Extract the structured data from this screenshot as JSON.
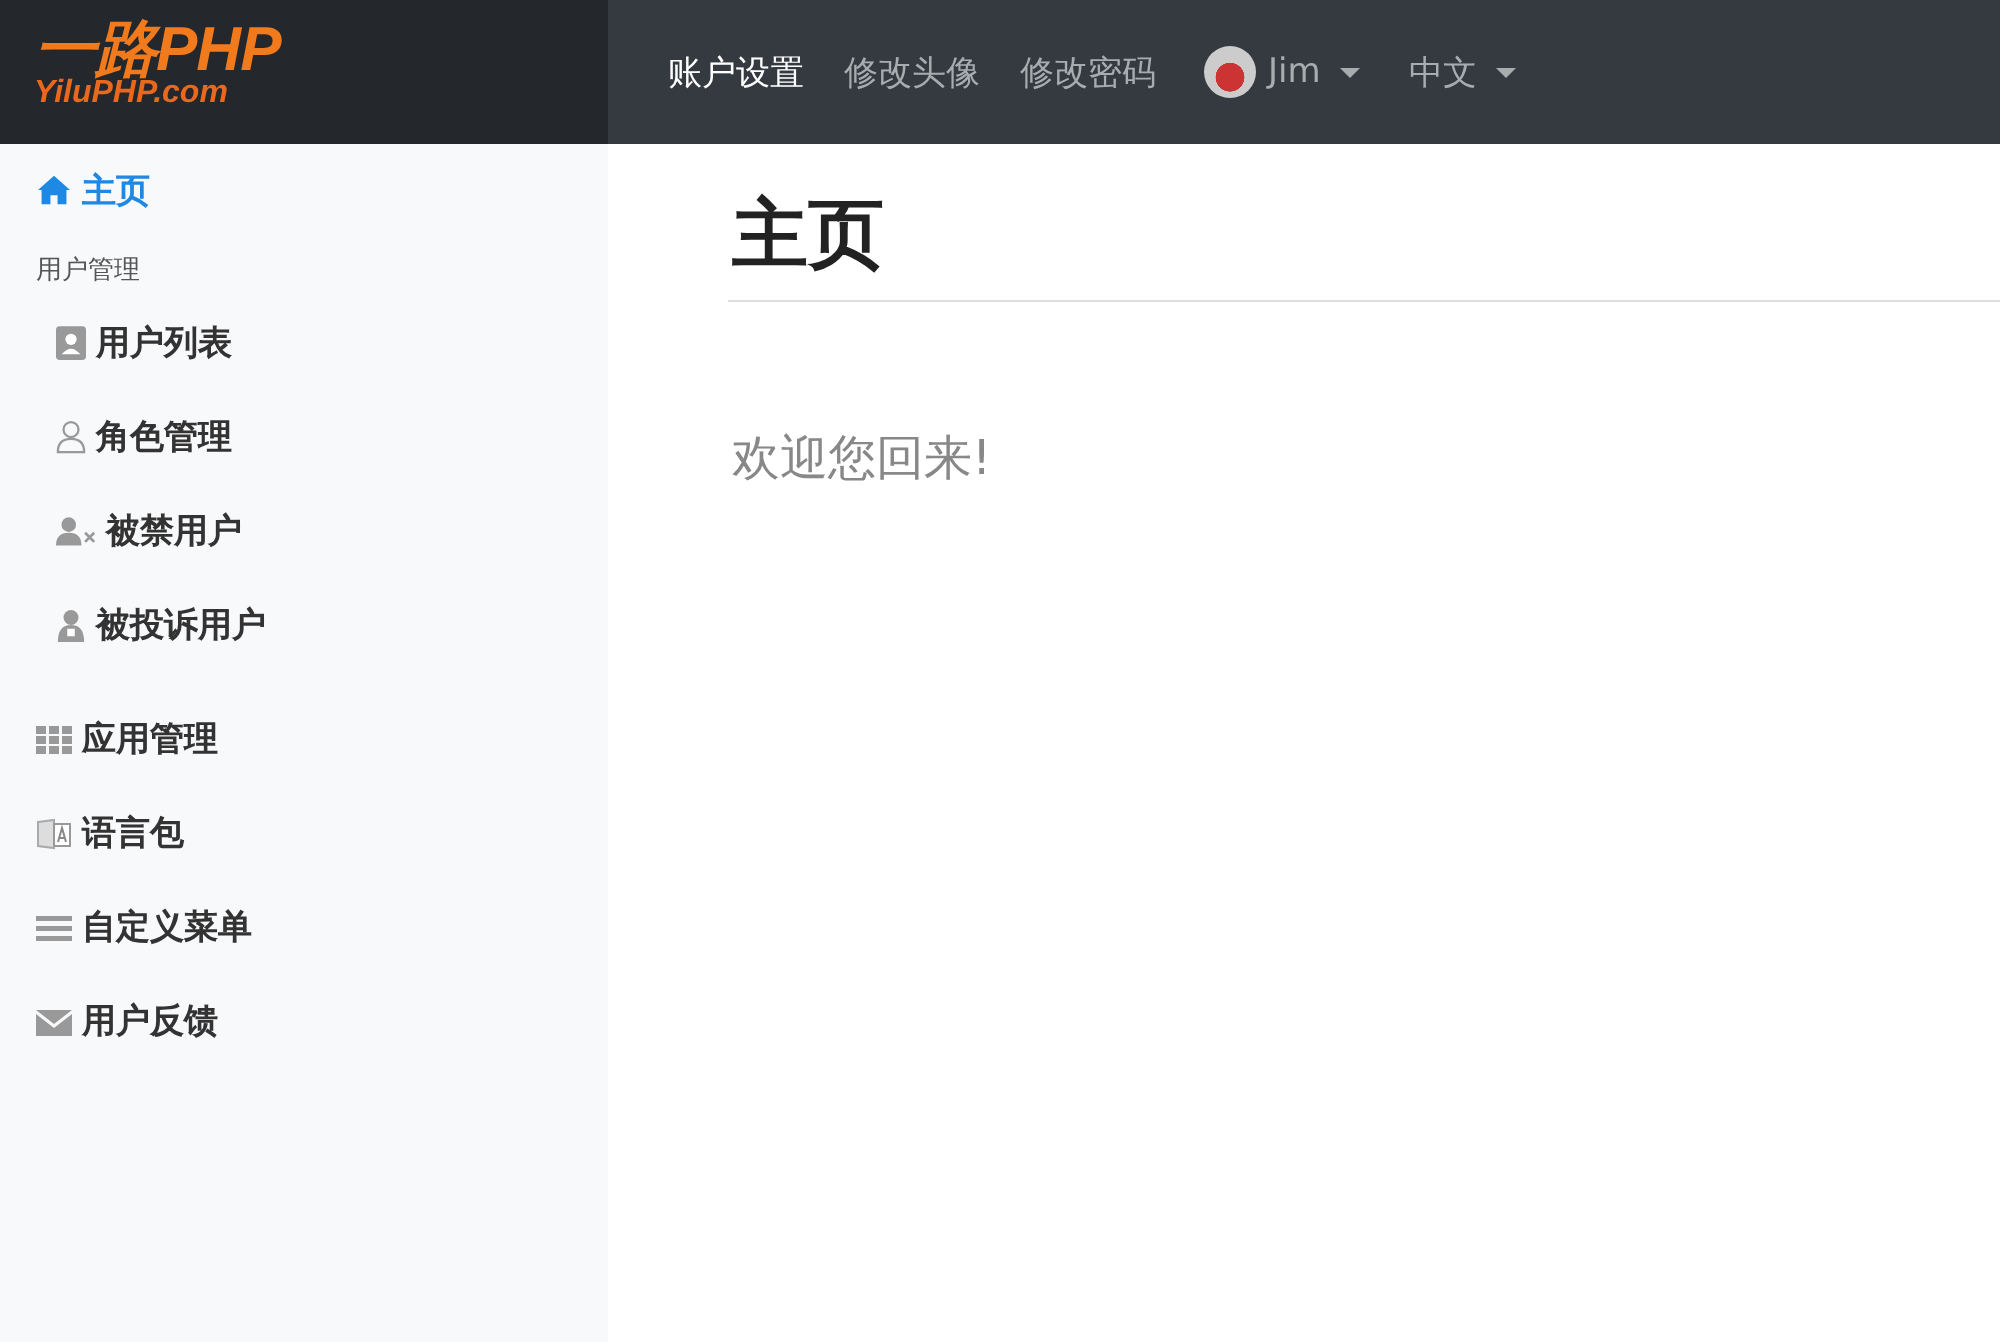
{
  "logo": {
    "title": "一路PHP",
    "subtitle": "YiluPHP.com"
  },
  "nav": {
    "links": [
      {
        "label": "账户设置",
        "selected": true
      },
      {
        "label": "修改头像",
        "selected": false
      },
      {
        "label": "修改密码",
        "selected": false
      }
    ],
    "user_menu": {
      "name": "Jim"
    },
    "language_menu": {
      "label": "中文"
    }
  },
  "sidebar": {
    "items": [
      {
        "kind": "link",
        "label": "主页",
        "selected": true
      },
      {
        "kind": "group",
        "label": "用户管理",
        "children": [
          {
            "label": "用户列表",
            "selected": false
          },
          {
            "label": "角色管理",
            "selected": false
          },
          {
            "label": "被禁用户",
            "selected": false
          },
          {
            "label": "被投诉用户",
            "selected": false
          }
        ]
      },
      {
        "kind": "link",
        "label": "应用管理",
        "selected": false
      },
      {
        "kind": "link",
        "label": "语言包",
        "selected": false
      },
      {
        "kind": "link",
        "label": "自定义菜单",
        "selected": false
      },
      {
        "kind": "link",
        "label": "用户反馈",
        "selected": false
      }
    ]
  },
  "main": {
    "title": "主页",
    "welcome": "欢迎您回来!"
  }
}
